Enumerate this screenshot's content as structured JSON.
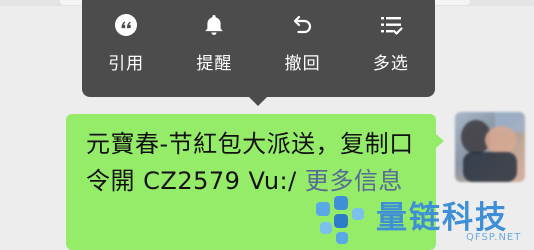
{
  "context_menu": {
    "items": [
      {
        "label": "引用",
        "icon": "quote-icon"
      },
      {
        "label": "提醒",
        "icon": "bell-icon"
      },
      {
        "label": "撤回",
        "icon": "undo-icon"
      },
      {
        "label": "多选",
        "icon": "multi-select-icon"
      }
    ]
  },
  "message": {
    "text": "元寶春-节紅包大派送，复制口令開 CZ2579 Vu:/ ",
    "more_link": "更多信息"
  },
  "watermark": {
    "title": "量链科技",
    "subtitle": "QFSP.NET"
  },
  "colors": {
    "menu_bg": "#4c4c4c",
    "bubble_bg": "#95ec69",
    "link": "#576b95",
    "watermark": "#3f8fd6"
  }
}
